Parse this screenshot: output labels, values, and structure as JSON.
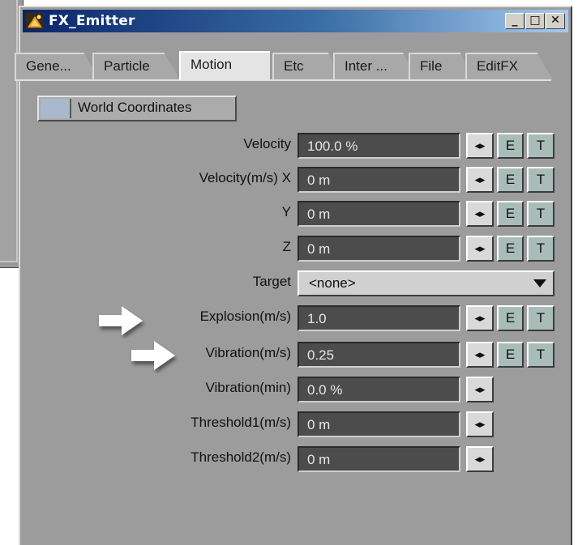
{
  "window": {
    "title": "FX_Emitter",
    "minimize_label": "_",
    "maximize_label": "□",
    "close_label": "✕"
  },
  "tabs": [
    {
      "label": "Gene...",
      "active": false
    },
    {
      "label": "Particle",
      "active": false
    },
    {
      "label": "Motion",
      "active": true
    },
    {
      "label": "Etc",
      "active": false
    },
    {
      "label": "Inter ...",
      "active": false
    },
    {
      "label": "File",
      "active": false
    },
    {
      "label": "EditFX",
      "active": false
    }
  ],
  "world_coordinates": {
    "label": "World Coordinates",
    "checked": false
  },
  "rows": [
    {
      "label": "Velocity",
      "value": "100.0 %",
      "has_e": true,
      "has_t": true
    },
    {
      "label": "Velocity(m/s) X",
      "value": "0 m",
      "has_e": true,
      "has_t": true
    },
    {
      "label": "Y",
      "value": "0 m",
      "has_e": true,
      "has_t": true
    },
    {
      "label": "Z",
      "value": "0 m",
      "has_e": true,
      "has_t": true
    },
    {
      "label": "Explosion(m/s)",
      "value": "1.0",
      "has_e": true,
      "has_t": true
    },
    {
      "label": "Vibration(m/s)",
      "value": "0.25",
      "has_e": true,
      "has_t": true
    },
    {
      "label": "Vibration(min)",
      "value": "0.0 %",
      "has_e": false,
      "has_t": false
    },
    {
      "label": "Threshold1(m/s)",
      "value": "0 m",
      "has_e": false,
      "has_t": false
    },
    {
      "label": "Threshold2(m/s)",
      "value": "0 m",
      "has_e": false,
      "has_t": false
    }
  ],
  "target": {
    "label": "Target",
    "value": "<none>"
  },
  "buttons": {
    "arrow_label": "◂▸",
    "e_label": "E",
    "t_label": "T"
  },
  "colors": {
    "field_bg": "#4c4c4c",
    "envelope_button": "#a8bdb7",
    "panel_bg": "#9c9c9c"
  },
  "icons": [
    "app-icon",
    "pointer-arrow-icon"
  ]
}
